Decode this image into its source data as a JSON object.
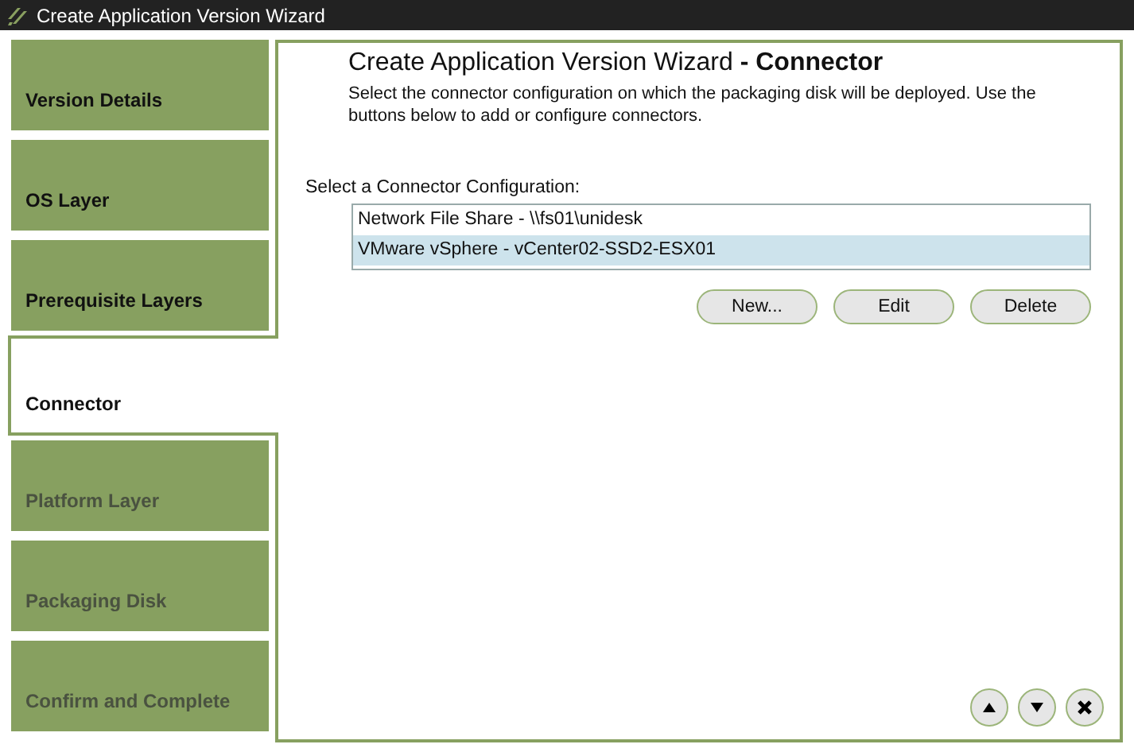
{
  "window": {
    "title": "Create Application Version Wizard"
  },
  "steps": [
    {
      "label": "Version Details",
      "selected": false,
      "disabled": false
    },
    {
      "label": "OS Layer",
      "selected": false,
      "disabled": false
    },
    {
      "label": "Prerequisite Layers",
      "selected": false,
      "disabled": false
    },
    {
      "label": "Connector",
      "selected": true,
      "disabled": false
    },
    {
      "label": "Platform Layer",
      "selected": false,
      "disabled": true
    },
    {
      "label": "Packaging Disk",
      "selected": false,
      "disabled": true
    },
    {
      "label": "Confirm and Complete",
      "selected": false,
      "disabled": true
    }
  ],
  "heading": {
    "title": "Create Application Version Wizard",
    "step": "- Connector"
  },
  "description": "Select the connector configuration on which the packaging disk will be deployed.  Use the buttons below to add or configure connectors.",
  "list_label": "Select a Connector Configuration:",
  "connectors": [
    {
      "label": "Network File Share - \\\\fs01\\unidesk",
      "selected": false
    },
    {
      "label": "VMware vSphere - vCenter02-SSD2-ESX01",
      "selected": true
    }
  ],
  "buttons": [
    "New...",
    "Edit",
    "Delete"
  ],
  "nav_buttons": [
    {
      "kind": "up"
    },
    {
      "kind": "down"
    },
    {
      "kind": "close"
    }
  ]
}
